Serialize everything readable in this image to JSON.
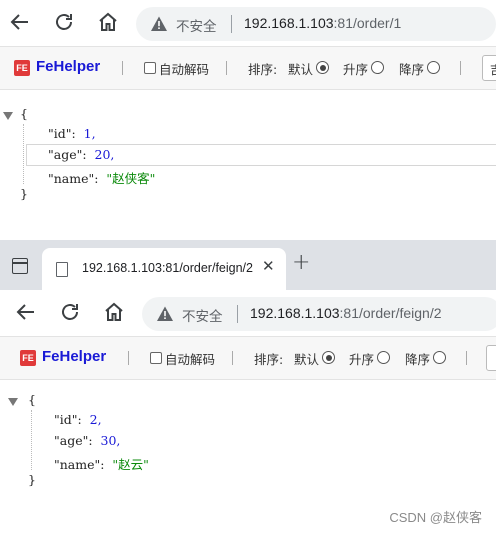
{
  "window1": {
    "nav": {
      "back": "back-icon",
      "reload": "reload-icon",
      "home": "home-icon"
    },
    "address": {
      "security": "不安全",
      "host": "192.168.1.103",
      "rest": ":81/order/1"
    },
    "fehelper": {
      "logo": "FE",
      "name": "FeHelper",
      "autodecode": "自动解码",
      "sort_label": "排序:",
      "sort_default": "默认",
      "sort_asc": "升序",
      "sort_desc": "降序",
      "edge_btn": "吉"
    },
    "json": {
      "open": "{",
      "close": "}",
      "lines": [
        {
          "key": "\"id\":",
          "value": "1,",
          "type": "num"
        },
        {
          "key": "\"age\":",
          "value": "20,",
          "type": "num"
        },
        {
          "key": "\"name\":",
          "value": "\"赵侠客\"",
          "type": "str"
        }
      ]
    }
  },
  "window2": {
    "tab": {
      "title": "192.168.1.103:81/order/feign/2",
      "close": "✕"
    },
    "newtab": "+",
    "address": {
      "security": "不安全",
      "host": "192.168.1.103",
      "rest": ":81/order/feign/2"
    },
    "fehelper": {
      "logo": "FE",
      "name": "FeHelper",
      "autodecode": "自动解码",
      "sort_label": "排序:",
      "sort_default": "默认",
      "sort_asc": "升序",
      "sort_desc": "降序"
    },
    "json": {
      "open": "{",
      "close": "}",
      "lines": [
        {
          "key": "\"id\":",
          "value": "2,",
          "type": "num"
        },
        {
          "key": "\"age\":",
          "value": "30,",
          "type": "num"
        },
        {
          "key": "\"name\":",
          "value": "\"赵云\"",
          "type": "str"
        }
      ]
    }
  },
  "watermark": "CSDN @赵侠客",
  "colors": {
    "fehelper_brand": "#1a1ad6",
    "fe_logo": "#e03a3a",
    "json_number": "#1a1ad6",
    "json_string": "#0b8a0b"
  }
}
